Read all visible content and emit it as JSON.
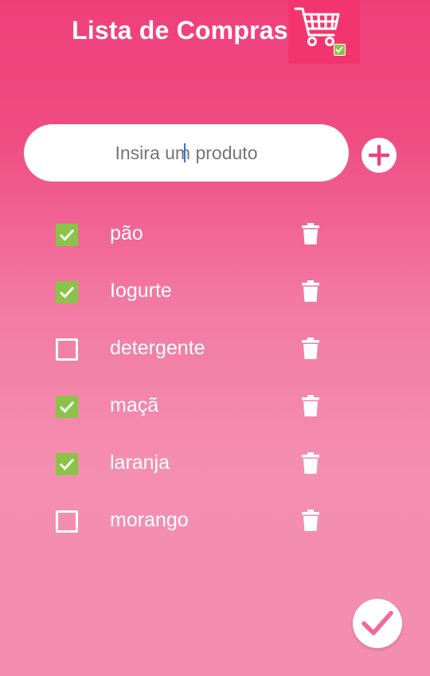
{
  "header": {
    "title": "Lista de Compras",
    "icon": "shopping-cart-check-icon"
  },
  "input": {
    "placeholder": "Insira um produto",
    "value": ""
  },
  "add_button": {
    "icon": "plus-icon"
  },
  "items": [
    {
      "label": "pão",
      "checked": true
    },
    {
      "label": "Iogurte",
      "checked": true
    },
    {
      "label": "detergente",
      "checked": false
    },
    {
      "label": "maçã",
      "checked": true
    },
    {
      "label": "laranja",
      "checked": true
    },
    {
      "label": "morango",
      "checked": false
    }
  ],
  "done_button": {
    "icon": "checkmark-icon"
  },
  "colors": {
    "background_top": "#ef3f7a",
    "background_bottom": "#f48db0",
    "accent": "#e9467c",
    "checkbox_checked": "#8bc34a"
  }
}
